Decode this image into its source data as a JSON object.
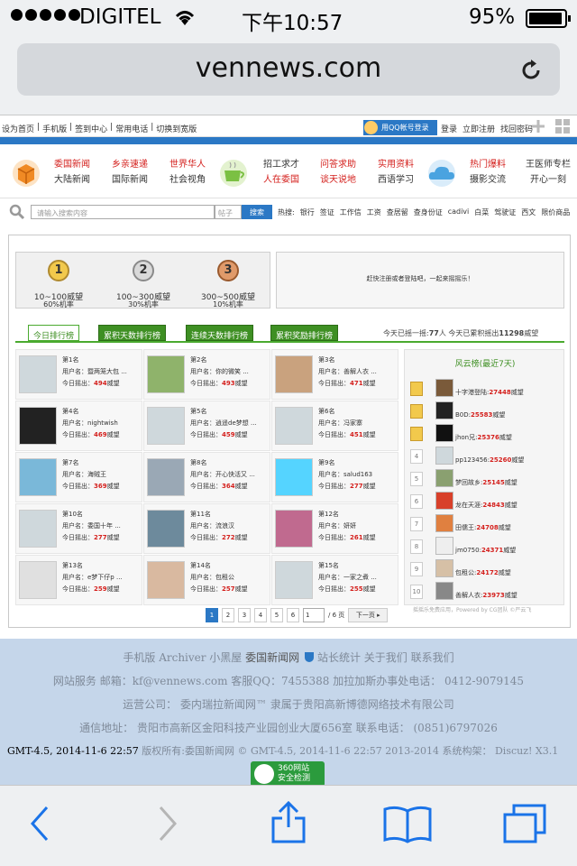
{
  "status": {
    "carrier": "DIGITEL",
    "time": "下午10:57",
    "battery": "95%"
  },
  "browser": {
    "url": "vennews.com"
  },
  "topbar": {
    "left_links": [
      "设为首页",
      "|",
      "手机版",
      "|",
      "签到中心",
      "|",
      "常用电话",
      "|",
      "切换到宽版"
    ],
    "qq_login": "用QQ帐号登录",
    "right_links": [
      "登录",
      "立即注册",
      "找回密码"
    ]
  },
  "nav": {
    "col1": {
      "top": "委国新闻",
      "bottom": "大陆新闻"
    },
    "col2": {
      "top": "乡亲速递",
      "bottom": "国际新闻"
    },
    "col3": {
      "top": "世界华人",
      "bottom": "社会视角"
    },
    "col4": {
      "top": "招工求才",
      "bottom": "人在委国"
    },
    "col5": {
      "top": "问答求助",
      "bottom": "谈天说地"
    },
    "col6": {
      "top": "实用资料",
      "bottom": "西语学习"
    },
    "col7": {
      "top": "热门爆料",
      "bottom": "摄影交流"
    },
    "col8": {
      "top": "王医师专栏",
      "bottom": "开心一刻"
    }
  },
  "search": {
    "placeholder": "请输入搜索内容",
    "scope": "帖子",
    "button": "搜索",
    "hot_label": "热搜:",
    "hot": [
      "银行",
      "签证",
      "工作信",
      "工资",
      "查居留",
      "查身份证",
      "cadivi",
      "白菜",
      "驾驶证",
      "西文",
      "限价商品"
    ]
  },
  "medals": [
    {
      "num": "1",
      "range": "10~100威望",
      "prob": "60%机率"
    },
    {
      "num": "2",
      "range": "100~300威望",
      "prob": "30%机率"
    },
    {
      "num": "3",
      "range": "300~500威望",
      "prob": "10%机率"
    }
  ],
  "notice": "赶快注册或者登陆吧，一起来摇摇乐！",
  "tabs": [
    "今日排行榜",
    "累积天数排行榜",
    "连续天数排行榜",
    "累积奖励排行榜"
  ],
  "tab_stats": {
    "p1": "今天已摇一摇:",
    "today": "77",
    "p2": "人   今天已累积摇出",
    "total": "11298",
    "p3": "威望"
  },
  "cell_labels": {
    "user": "用户名：",
    "today": "今日摇出：",
    "unit": "威望"
  },
  "ranks": [
    {
      "rank": "第1名",
      "name": "暨两笼大包 ...",
      "value": "494"
    },
    {
      "rank": "第2名",
      "name": "你的微笑 ...",
      "value": "493"
    },
    {
      "rank": "第3名",
      "name": "善解人衣 ...",
      "value": "471"
    },
    {
      "rank": "第4名",
      "name": "nightwish",
      "value": "469"
    },
    {
      "rank": "第5名",
      "name": "逍遥de梦想 ...",
      "value": "459"
    },
    {
      "rank": "第6名",
      "name": "冯家寨",
      "value": "451"
    },
    {
      "rank": "第7名",
      "name": "海贼王",
      "value": "369"
    },
    {
      "rank": "第8名",
      "name": "开心快活又 ...",
      "value": "364"
    },
    {
      "rank": "第9名",
      "name": "salud163",
      "value": "277"
    },
    {
      "rank": "第10名",
      "name": "委国十年 ...",
      "value": "277"
    },
    {
      "rank": "第11名",
      "name": "流浪汉",
      "value": "272"
    },
    {
      "rank": "第12名",
      "name": "妍妍",
      "value": "261"
    },
    {
      "rank": "第13名",
      "name": "e梦下仔p ...",
      "value": "259"
    },
    {
      "rank": "第14名",
      "name": "包租公",
      "value": "257"
    },
    {
      "rank": "第15名",
      "name": "一家之煮 ...",
      "value": "255"
    }
  ],
  "side": {
    "title": "风云榜(最近7天)",
    "rows": [
      {
        "num": "",
        "name": "十字港登陆:",
        "value": "27448"
      },
      {
        "num": "",
        "name": "B0D:",
        "value": "25583"
      },
      {
        "num": "",
        "name": "jhon兄:",
        "value": "25376"
      },
      {
        "num": "4",
        "name": "pp123456:",
        "value": "25260"
      },
      {
        "num": "5",
        "name": "梦回故乡:",
        "value": "25145"
      },
      {
        "num": "6",
        "name": "龙在天涯:",
        "value": "24843"
      },
      {
        "num": "7",
        "name": "田儒王:",
        "value": "24708"
      },
      {
        "num": "8",
        "name": "jm0750:",
        "value": "24371"
      },
      {
        "num": "9",
        "name": "包租公:",
        "value": "24172"
      },
      {
        "num": "10",
        "name": "善解人衣:",
        "value": "23973"
      }
    ],
    "unit": "威望"
  },
  "pager": {
    "pages": [
      "1",
      "2",
      "3",
      "4",
      "5",
      "6"
    ],
    "input": "1",
    "total": "/ 6 页",
    "next": "下一页 ▸"
  },
  "tagline": "摇摇乐免费应用，Powered by CG团队 ©严云飞",
  "footer": {
    "l1a": "手机版   Archiver   小黑屋   ",
    "l1b": "委国新闻网",
    "l1c": "  站长统计  关于我们  联系我们",
    "l2": "网站服务 邮箱：kf@vennews.com  客服QQ：7455388  加拉加斯办事处电话：  0412-9079145",
    "l3": "运营公司：   委内瑞拉新闻网™ 隶属于贵阳高新博德网络技术有限公司",
    "l4": "通信地址：  贵阳市高新区金阳科技产业园创业大厦656室  联系电话：  (0851)6797026",
    "gmt_a": "GMT-4.5, 2014-11-6 22:57",
    "gmt_b": " 版权所有:委国新闻网 © GMT-4.5, 2014-11-6 22:57 2013-2014  系统构架：  Discuz! X3.1",
    "badge_a": "360网站",
    "badge_b": "安全检测"
  }
}
